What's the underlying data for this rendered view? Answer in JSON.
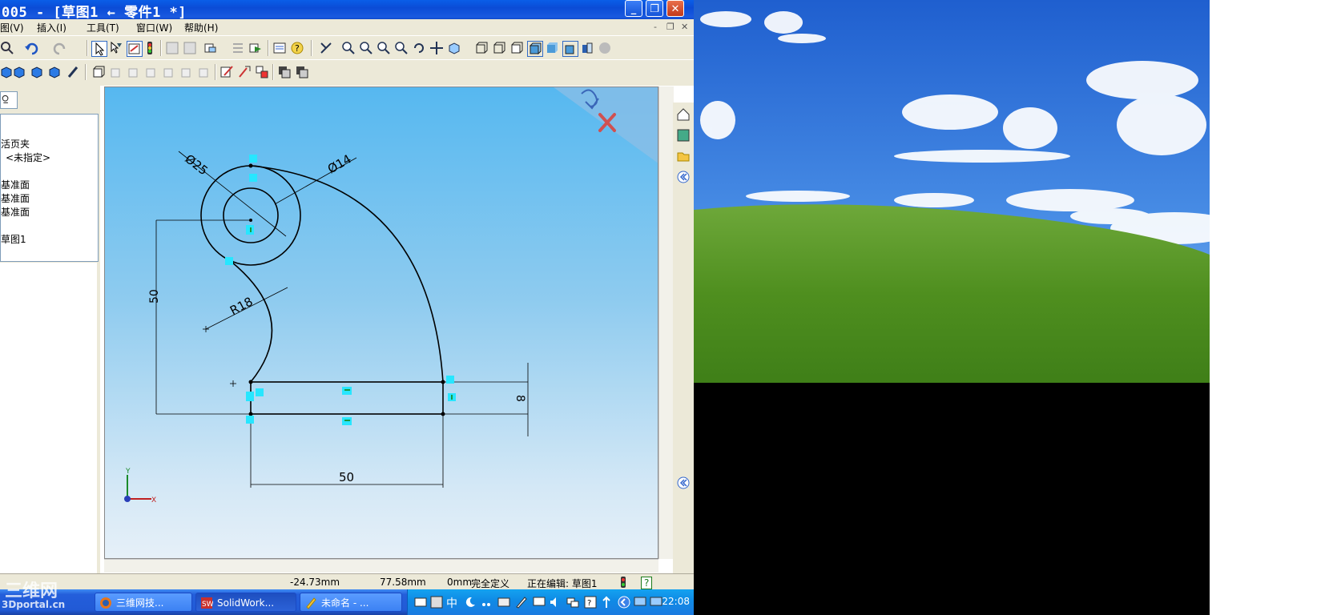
{
  "window": {
    "title": "005 - [草图1 ← 零件1 *]",
    "minimize_label": "_",
    "maximize_label": "❐",
    "close_label": "✕"
  },
  "menu": {
    "items": [
      "图(V)",
      "插入(I)",
      "工具(T)",
      "窗口(W)",
      "帮助(H)"
    ],
    "mdi_minimize": "-",
    "mdi_restore": "❐",
    "mdi_close": "✕"
  },
  "feature_tree": {
    "items": [
      "活页夹",
      "<未指定>",
      "基准面",
      "基准面",
      "基准面",
      "草图1"
    ]
  },
  "drawing": {
    "dims": {
      "d1": "Ø25",
      "d2": "Ø14",
      "d3": "50",
      "d4": "R18",
      "d5": "8",
      "d6": "50"
    },
    "axis_y": "Y",
    "axis_x": "X"
  },
  "status": {
    "x": "-24.73mm",
    "y": "77.58mm",
    "z": "0mm",
    "state": "完全定义",
    "editing": "正在编辑: 草图1",
    "help": "?"
  },
  "taskbar": {
    "tasks": [
      "三维网技...",
      "SolidWork...",
      "未命名 - ..."
    ],
    "time": "22:08",
    "ime": "中"
  },
  "watermark": {
    "line1": "三维网",
    "line2": "3Dportal.cn"
  },
  "colors": {
    "accent": "#0b4cd6",
    "sketch_line": "#000000",
    "relation_marker": "#27e6ff"
  }
}
